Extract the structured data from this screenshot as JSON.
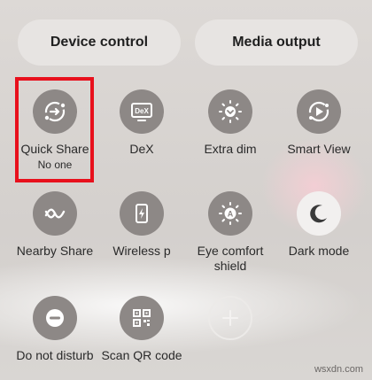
{
  "header": {
    "device_control": "Device control",
    "media_output": "Media output"
  },
  "tiles": [
    {
      "label": "Quick Share",
      "sub": "No one",
      "icon": "quick-share-icon"
    },
    {
      "label": "DeX",
      "icon": "dex-icon",
      "icon_text": "DeX"
    },
    {
      "label": "Extra dim",
      "icon": "extra-dim-icon"
    },
    {
      "label": "Smart View",
      "icon": "smart-view-icon"
    },
    {
      "label": "Nearby Share",
      "icon": "nearby-share-icon"
    },
    {
      "label": "Wireless p",
      "icon": "wireless-powershare-icon"
    },
    {
      "label": "Eye comfort shield",
      "icon": "eye-comfort-icon",
      "icon_text": "A"
    },
    {
      "label": "Dark mode",
      "icon": "moon-icon",
      "state": "on"
    },
    {
      "label": "Do not disturb",
      "icon": "minus-icon"
    },
    {
      "label": "Scan QR code",
      "icon": "qr-code-icon"
    }
  ],
  "add_tile": {
    "icon": "plus-icon"
  },
  "colors": {
    "tile_off": "#8d8886",
    "tile_on": "#f2f0ef",
    "highlight": "#e8101c"
  },
  "watermark": "wsxdn.com"
}
